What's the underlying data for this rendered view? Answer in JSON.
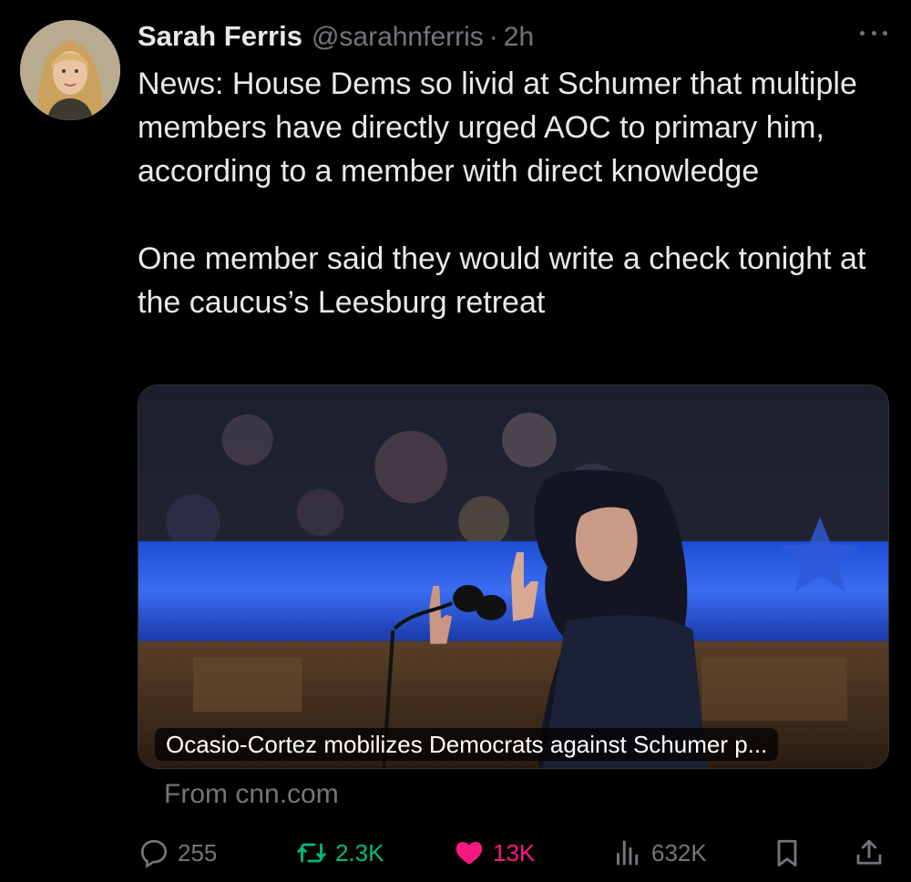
{
  "author": {
    "name": "Sarah Ferris",
    "handle": "@sarahnferris",
    "separator": "·",
    "time": "2h"
  },
  "tweet": {
    "paragraphs": [
      "News: House Dems so livid at Schumer that multiple members have directly urged AOC to primary him, according to a member with direct knowledge",
      "One member said they would write a check tonight at the caucus’s Leesburg retreat"
    ]
  },
  "card": {
    "caption": "Ocasio-Cortez mobilizes Democrats against Schumer p...",
    "source": "From cnn.com"
  },
  "actions": {
    "replies": "255",
    "retweets": "2.3K",
    "likes": "13K",
    "views": "632K"
  },
  "colors": {
    "background": "#000000",
    "text": "#e7e9ea",
    "muted": "#71767b",
    "retweet": "#00ba7c",
    "like": "#f91880"
  },
  "icons": [
    "more-icon",
    "reply-icon",
    "retweet-icon",
    "heart-icon",
    "views-icon",
    "bookmark-icon",
    "share-icon"
  ]
}
